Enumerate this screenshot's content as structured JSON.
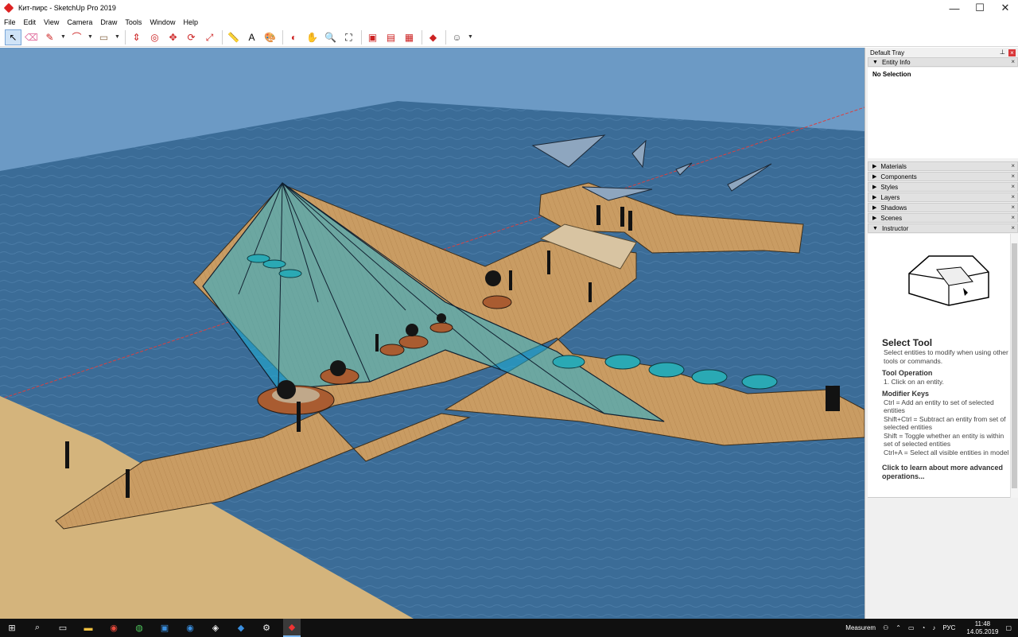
{
  "window": {
    "title": "Кит-пирс - SketchUp Pro 2019",
    "minimize": "—",
    "maximize": "☐",
    "close": "✕"
  },
  "menu": [
    "File",
    "Edit",
    "View",
    "Camera",
    "Draw",
    "Tools",
    "Window",
    "Help"
  ],
  "toolbar": {
    "tools": [
      {
        "name": "select-tool",
        "glyph": "↖"
      },
      {
        "name": "eraser-tool",
        "glyph": "⌫"
      },
      {
        "name": "line-tool",
        "glyph": "✎"
      },
      {
        "name": "arc-tool",
        "glyph": "⌒"
      },
      {
        "name": "rectangle-tool",
        "glyph": "▭"
      },
      {
        "name": "push-pull-tool",
        "glyph": "⇕"
      },
      {
        "name": "offset-tool",
        "glyph": "◎"
      },
      {
        "name": "move-tool",
        "glyph": "✥"
      },
      {
        "name": "rotate-tool",
        "glyph": "⟳"
      },
      {
        "name": "scale-tool",
        "glyph": "⤢"
      },
      {
        "name": "tape-measure-tool",
        "glyph": "📏"
      },
      {
        "name": "text-tool",
        "glyph": "A"
      },
      {
        "name": "paint-bucket-tool",
        "glyph": "🎨"
      },
      {
        "name": "orbit-tool",
        "glyph": "◐"
      },
      {
        "name": "pan-tool",
        "glyph": "✋"
      },
      {
        "name": "zoom-tool",
        "glyph": "🔍"
      },
      {
        "name": "zoom-extents-tool",
        "glyph": "⛶"
      },
      {
        "name": "3d-warehouse-tool",
        "glyph": "▣"
      },
      {
        "name": "extension-warehouse-tool",
        "glyph": "▤"
      },
      {
        "name": "layout-tool",
        "glyph": "▦"
      },
      {
        "name": "ruby-console-tool",
        "glyph": "◆"
      },
      {
        "name": "account-tool",
        "glyph": "☺"
      }
    ]
  },
  "tray": {
    "title": "Default Tray",
    "pin": "⊥",
    "close": "×",
    "entity_info": {
      "label": "Entity Info",
      "status": "No Selection"
    },
    "panels": [
      "Materials",
      "Components",
      "Styles",
      "Layers",
      "Shadows",
      "Scenes"
    ],
    "instructor": {
      "label": "Instructor",
      "heading": "Select Tool",
      "description": "Select entities to modify when using other tools or commands.",
      "op_heading": "Tool Operation",
      "op_text": "1. Click on an entity.",
      "keys_heading": "Modifier Keys",
      "keys": [
        "Ctrl = Add an entity to set of selected entities",
        "Shift+Ctrl = Subtract an entity from set of selected entities",
        "Shift = Toggle whether an entity is within set of selected entities",
        "Ctrl+A = Select all visible entities in model"
      ],
      "link": "Click to learn about more advanced operations..."
    }
  },
  "taskbar": {
    "status_text": "Measurem",
    "lang": "РУС",
    "time": "11:48",
    "date": "14.05.2019"
  },
  "colors": {
    "water": "#3c6e98",
    "sky": "#6a99c4",
    "sand": "#d4b47c",
    "deck": "#c89b62",
    "canopy": "#20b4d8",
    "accent": "#cfe3f7"
  }
}
